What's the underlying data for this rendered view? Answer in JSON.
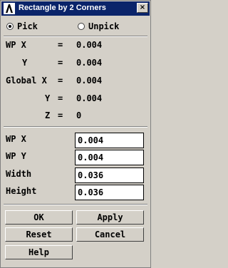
{
  "window": {
    "title": "Rectangle by 2 Corners",
    "close_glyph": "×"
  },
  "mode": {
    "pick_label": "Pick",
    "unpick_label": "Unpick",
    "selected": "pick"
  },
  "readout": {
    "wp_x_label": "WP X",
    "wp_y_label": "Y",
    "global_x_label": "Global X",
    "global_y_label": "Y",
    "global_z_label": "Z",
    "equals": "=",
    "wp_x": "0.004",
    "wp_y": "0.004",
    "global_x": "0.004",
    "global_y": "0.004",
    "global_z": "0"
  },
  "fields": {
    "wp_x_label": "WP X",
    "wp_x_value": "0.004",
    "wp_y_label": "WP Y",
    "wp_y_value": "0.004",
    "width_label": "Width",
    "width_value": "0.036",
    "height_label": "Height",
    "height_value": "0.036"
  },
  "buttons": {
    "ok": "OK",
    "apply": "Apply",
    "reset": "Reset",
    "cancel": "Cancel",
    "help": "Help"
  },
  "colors": {
    "titlebar": "#0a246a",
    "dialog_bg": "#d4d0c8"
  }
}
